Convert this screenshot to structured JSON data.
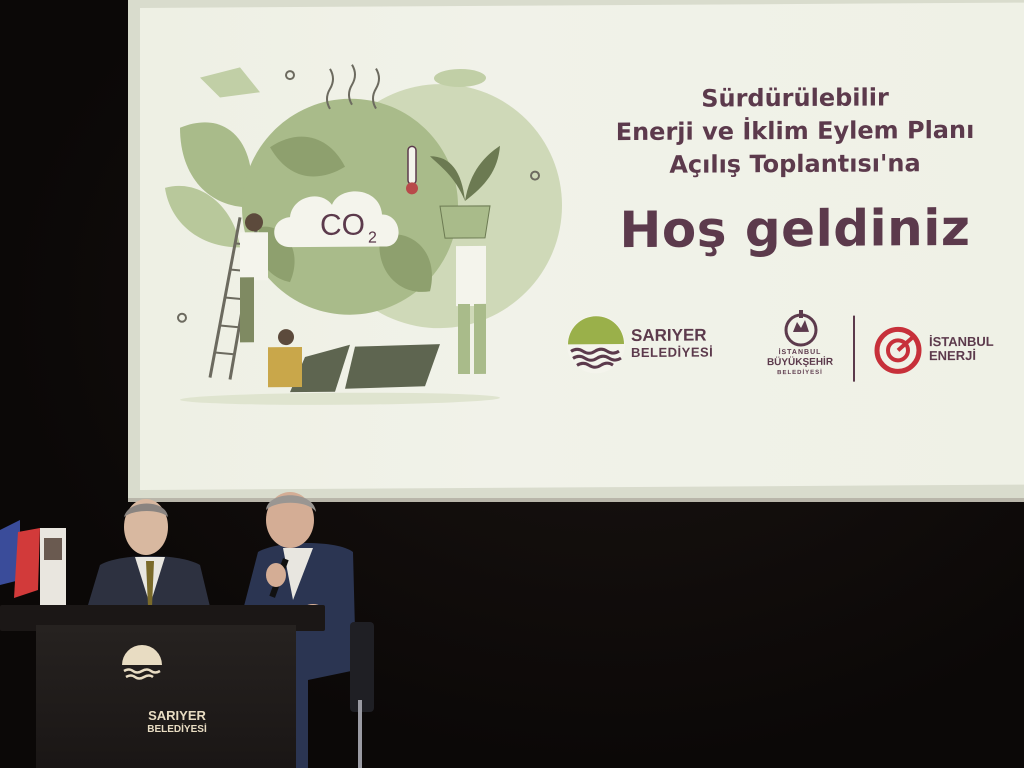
{
  "slide": {
    "title_line1": "Sürdürülebilir",
    "title_line2": "Enerji ve İklim Eylem Planı",
    "title_line3": "Açılış Toplantısı'na",
    "welcome": "Hoş geldiniz",
    "co2_label": "CO",
    "co2_sub": "2"
  },
  "logos": {
    "sariyer_line1": "SARIYER",
    "sariyer_line2": "BELEDİYESİ",
    "ibb_line1": "İSTANBUL",
    "ibb_line2": "BÜYÜKŞEHİR",
    "ibb_line3": "BELEDİYESİ",
    "energy_line1": "İSTANBUL",
    "energy_line2": "ENERJİ"
  },
  "podium": {
    "logo_line1": "SARIYER",
    "logo_line2": "BELEDİYESİ"
  },
  "colors": {
    "title": "#5c3a4c",
    "illustration_green": "#a9bb8a",
    "energy_red": "#c7303a"
  }
}
